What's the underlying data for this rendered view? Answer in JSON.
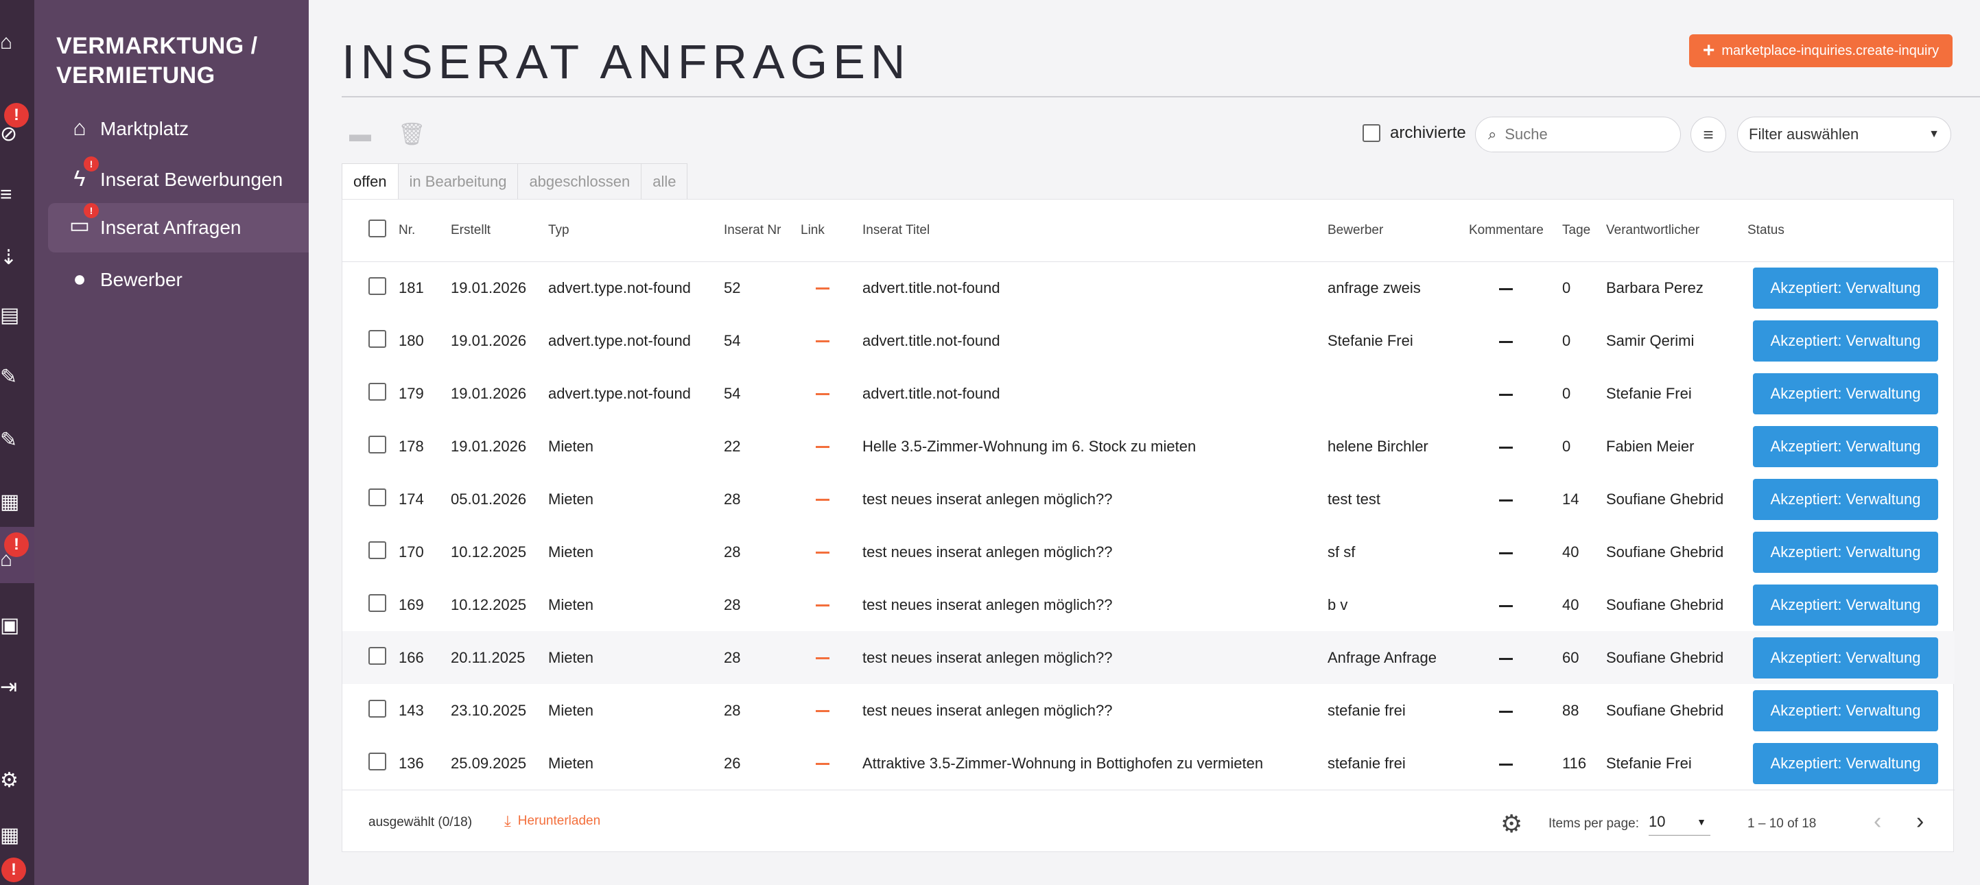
{
  "sidebar": {
    "section_title": "VERMARKTUNG / VERMIETUNG",
    "items": [
      {
        "label": "Marktplatz",
        "icon": "marketplace-icon"
      },
      {
        "label": "Inserat Bewerbungen",
        "icon": "flash-icon",
        "badge": "!"
      },
      {
        "label": "Inserat Anfragen",
        "icon": "chat-icon",
        "badge": "!"
      },
      {
        "label": "Bewerber",
        "icon": "person-icon"
      }
    ]
  },
  "rail": {
    "badges": [
      "!",
      "!",
      "!"
    ]
  },
  "header": {
    "title": "INSERAT ANFRAGEN",
    "create_button_label": "marketplace-inquiries.create-inquiry"
  },
  "toolbar": {
    "archived_label": "archivierte",
    "search_placeholder": "Suche",
    "filter_select_value": "Filter auswählen"
  },
  "tabs": [
    {
      "label": "offen",
      "active": true
    },
    {
      "label": "in Bearbeitung",
      "active": false
    },
    {
      "label": "abgeschlossen",
      "active": false
    },
    {
      "label": "alle",
      "active": false
    }
  ],
  "table": {
    "columns": [
      "Nr.",
      "Erstellt",
      "Typ",
      "Inserat Nr",
      "Link",
      "Inserat Titel",
      "Bewerber",
      "Kommentare",
      "Tage",
      "Verantwortlicher",
      "Status"
    ],
    "rows": [
      {
        "nr": "181",
        "created": "19.01.2026",
        "type": "advert.type.not-found",
        "advert_nr": "52",
        "title": "advert.title.not-found",
        "applicant": "anfrage zweis",
        "days": "0",
        "responsible": "Barbara Perez",
        "status": "Akzeptiert: Verwaltung"
      },
      {
        "nr": "180",
        "created": "19.01.2026",
        "type": "advert.type.not-found",
        "advert_nr": "54",
        "title": "advert.title.not-found",
        "applicant": "Stefanie Frei",
        "days": "0",
        "responsible": "Samir Qerimi",
        "status": "Akzeptiert: Verwaltung"
      },
      {
        "nr": "179",
        "created": "19.01.2026",
        "type": "advert.type.not-found",
        "advert_nr": "54",
        "title": "advert.title.not-found",
        "applicant": "",
        "days": "0",
        "responsible": "Stefanie Frei",
        "status": "Akzeptiert: Verwaltung"
      },
      {
        "nr": "178",
        "created": "19.01.2026",
        "type": "Mieten",
        "advert_nr": "22",
        "title": "Helle 3.5-Zimmer-Wohnung im 6. Stock zu mieten",
        "applicant": "helene Birchler",
        "days": "0",
        "responsible": "Fabien Meier",
        "status": "Akzeptiert: Verwaltung"
      },
      {
        "nr": "174",
        "created": "05.01.2026",
        "type": "Mieten",
        "advert_nr": "28",
        "title": "test neues inserat anlegen möglich??",
        "applicant": "test test",
        "days": "14",
        "responsible": "Soufiane Ghebrid",
        "status": "Akzeptiert: Verwaltung"
      },
      {
        "nr": "170",
        "created": "10.12.2025",
        "type": "Mieten",
        "advert_nr": "28",
        "title": "test neues inserat anlegen möglich??",
        "applicant": "sf sf",
        "days": "40",
        "responsible": "Soufiane Ghebrid",
        "status": "Akzeptiert: Verwaltung"
      },
      {
        "nr": "169",
        "created": "10.12.2025",
        "type": "Mieten",
        "advert_nr": "28",
        "title": "test neues inserat anlegen möglich??",
        "applicant": "b v",
        "days": "40",
        "responsible": "Soufiane Ghebrid",
        "status": "Akzeptiert: Verwaltung"
      },
      {
        "nr": "166",
        "created": "20.11.2025",
        "type": "Mieten",
        "advert_nr": "28",
        "title": "test neues inserat anlegen möglich??",
        "applicant": "Anfrage Anfrage",
        "days": "60",
        "responsible": "Soufiane Ghebrid",
        "status": "Akzeptiert: Verwaltung",
        "hover": true
      },
      {
        "nr": "143",
        "created": "23.10.2025",
        "type": "Mieten",
        "advert_nr": "28",
        "title": "test neues inserat anlegen möglich??",
        "applicant": "stefanie frei",
        "days": "88",
        "responsible": "Soufiane Ghebrid",
        "status": "Akzeptiert: Verwaltung"
      },
      {
        "nr": "136",
        "created": "25.09.2025",
        "type": "Mieten",
        "advert_nr": "26",
        "title": "Attraktive 3.5-Zimmer-Wohnung in Bottighofen zu vermieten",
        "applicant": "stefanie frei",
        "days": "116",
        "responsible": "Stefanie Frei",
        "status": "Akzeptiert: Verwaltung"
      }
    ]
  },
  "footer": {
    "selected_label": "ausgewählt (0/18)",
    "download_label": "Herunterladen",
    "items_per_page_label": "Items per page:",
    "items_per_page_value": "10",
    "range_label": "1 – 10 of 18"
  },
  "colors": {
    "sidebar": "#5b4361",
    "rail": "#3b2a3e",
    "accent": "#f36f3c",
    "status": "#3196de",
    "badge": "#e53935"
  }
}
